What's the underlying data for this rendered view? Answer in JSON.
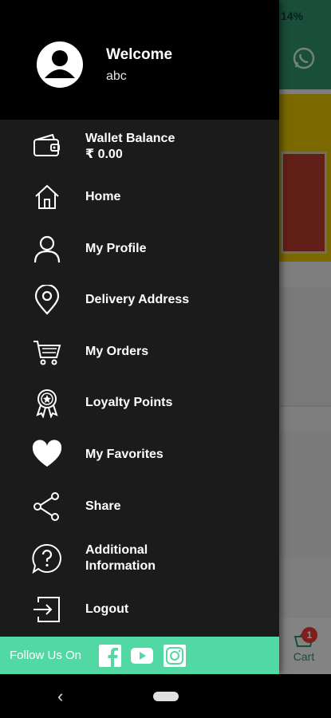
{
  "background": {
    "battery": "14%",
    "cart_label": "Cart",
    "cart_badge": "1"
  },
  "drawer": {
    "welcome": "Welcome",
    "username": "abc",
    "wallet": {
      "label": "Wallet Balance",
      "value": "₹ 0.00"
    },
    "items": [
      {
        "label": "Home",
        "icon": "home-icon"
      },
      {
        "label": "My Profile",
        "icon": "user-icon"
      },
      {
        "label": "Delivery Address",
        "icon": "location-pin-icon"
      },
      {
        "label": "My Orders",
        "icon": "cart-icon"
      },
      {
        "label": "Loyalty Points",
        "icon": "badge-icon"
      },
      {
        "label": "My Favorites",
        "icon": "heart-icon"
      },
      {
        "label": "Share",
        "icon": "share-icon"
      },
      {
        "label": "Additional Information",
        "icon": "question-icon"
      },
      {
        "label": "Logout",
        "icon": "logout-icon"
      }
    ],
    "follow": {
      "label": "Follow Us On",
      "networks": [
        "facebook-icon",
        "youtube-icon",
        "instagram-icon"
      ]
    }
  },
  "colors": {
    "drawer_bg": "#1b1b1b",
    "header_bg": "#000000",
    "accent": "#52d8a3",
    "brand_green": "#2c8f6a"
  }
}
